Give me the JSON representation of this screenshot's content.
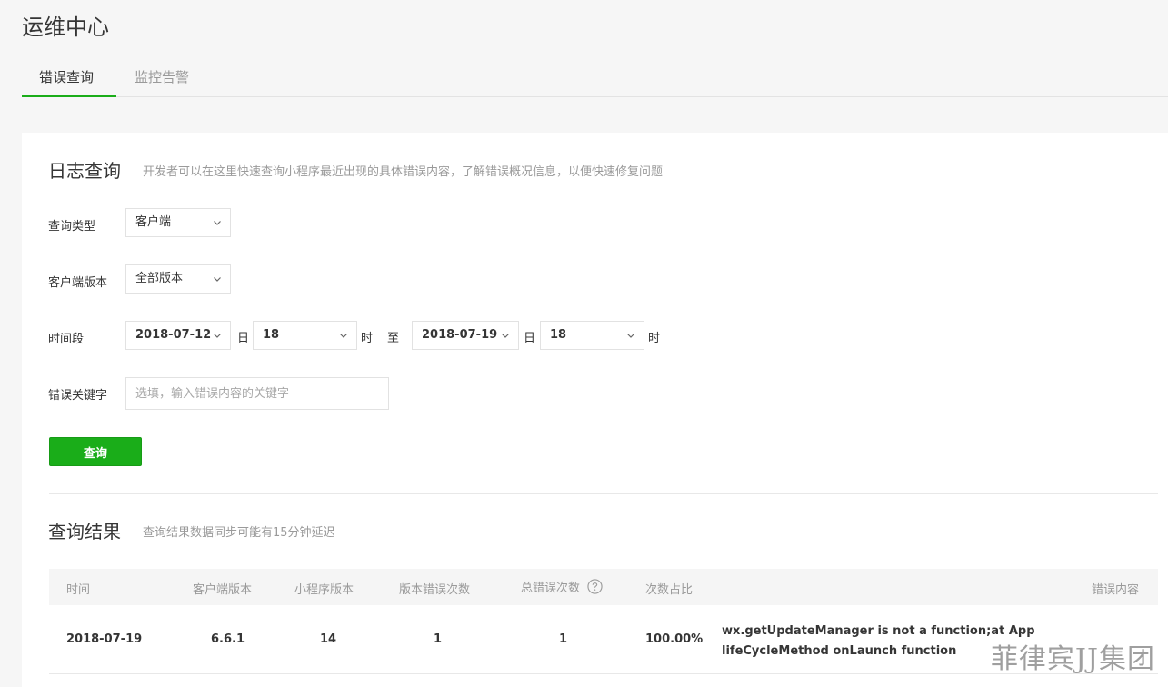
{
  "page": {
    "title": "运维中心"
  },
  "tabs": [
    {
      "label": "错误查询",
      "active": true
    },
    {
      "label": "监控告警",
      "active": false
    }
  ],
  "log_query": {
    "title": "日志查询",
    "description": "开发者可以在这里快速查询小程序最近出现的具体错误内容，了解错误概况信息，以便快速修复问题"
  },
  "form": {
    "query_type": {
      "label": "查询类型",
      "value": "客户端"
    },
    "client_version": {
      "label": "客户端版本",
      "value": "全部版本"
    },
    "time_range": {
      "label": "时间段",
      "start_date": "2018-07-12",
      "start_day_unit": "日",
      "start_hour": "18",
      "start_hour_unit": "时",
      "to": "至",
      "end_date": "2018-07-19",
      "end_day_unit": "日",
      "end_hour": "18",
      "end_hour_unit": "时"
    },
    "keyword": {
      "label": "错误关键字",
      "placeholder": "选填，输入错误内容的关键字"
    },
    "submit_label": "查询"
  },
  "results": {
    "title": "查询结果",
    "description": "查询结果数据同步可能有15分钟延迟",
    "columns": [
      "时间",
      "客户端版本",
      "小程序版本",
      "版本错误次数",
      "总错误次数",
      "次数占比",
      "错误内容"
    ],
    "rows": [
      {
        "time": "2018-07-19",
        "client_version": "6.6.1",
        "app_version": "14",
        "version_errors": "1",
        "total_errors": "1",
        "ratio": "100.00%",
        "content": "wx.getUpdateManager is not a function;at App lifeCycleMethod onLaunch function"
      }
    ]
  },
  "watermark": "菲律宾JJ集团",
  "colors": {
    "accent": "#1aad19",
    "muted": "#9a9a9a",
    "text": "#353535"
  },
  "icons": {
    "select_arrow": "chevron-down-icon",
    "help": "question-circle-icon"
  }
}
